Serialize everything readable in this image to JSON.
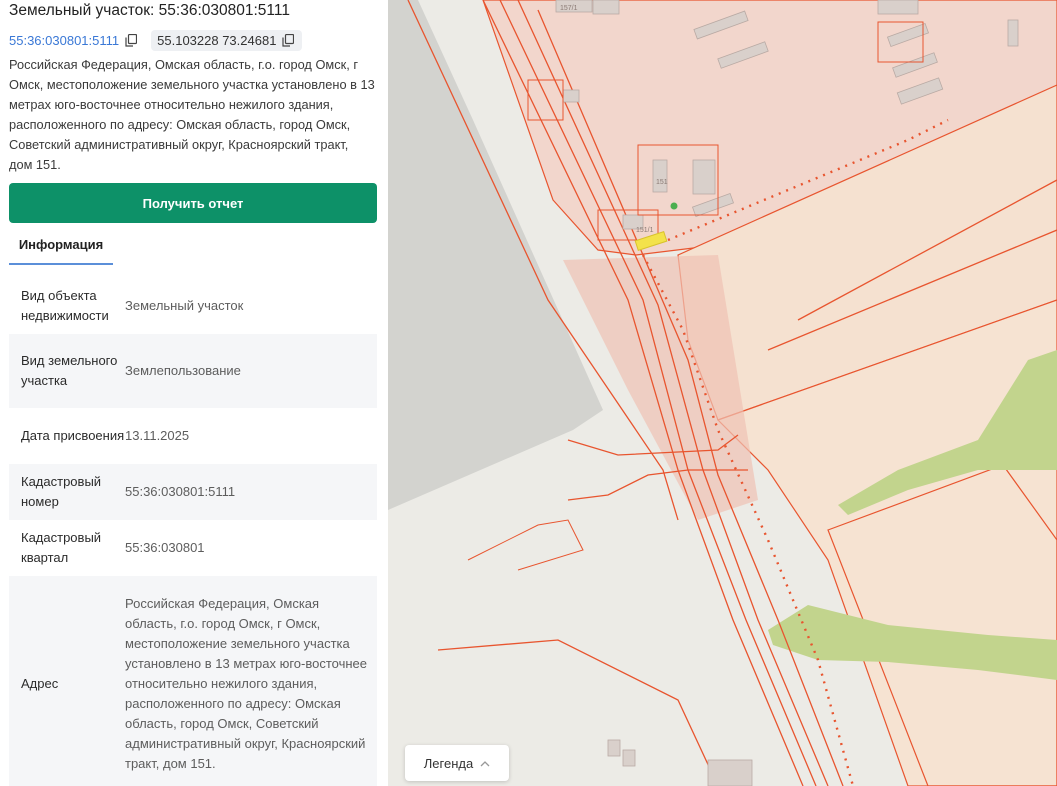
{
  "header": {
    "title": "Земельный участок: 55:36:030801:5111",
    "cadastral_link": "55:36:030801:5111",
    "coordinates": "55.103228 73.24681"
  },
  "description": "Российская Федерация, Омская область, г.о. город Омск, г Омск, местоположение земельного участка установлено в 13 метрах юго-восточнее относительно нежилого здания, расположенного по адресу: Омская область, город Омск, Советский административный округ, Красноярский тракт, дом 151.",
  "report_button": "Получить отчет",
  "tabs": [
    {
      "label": "Информация",
      "active": true
    }
  ],
  "info_rows": [
    {
      "key": "Вид объекта недвижимости",
      "value": "Земельный участок"
    },
    {
      "key": "Вид земельного участка",
      "value": "Землепользование"
    },
    {
      "key": "Дата присвоения",
      "value": "13.11.2025"
    },
    {
      "key": "Кадастровый номер",
      "value": "55:36:030801:5111"
    },
    {
      "key": "Кадастровый квартал",
      "value": "55:36:030801"
    },
    {
      "key": "Адрес",
      "value": "Российская Федерация, Омская область, г.о. город Омск, г Омск, местоположение земельного участка установлено в 13 метрах юго-восточнее относительно нежилого здания, расположенного по адресу: Омская область, город Омск, Советский административный округ, Красноярский тракт, дом 151."
    }
  ],
  "map": {
    "building_labels": [
      "157/1",
      "151",
      "151/1"
    ],
    "legend_label": "Легенда"
  },
  "colors": {
    "accent_green": "#0d9168",
    "link_blue": "#3a78d6",
    "parcel_stroke": "#e8552f",
    "parcel_fill": "#f4cfc3",
    "selected_parcel": "#f3e24a",
    "vegetation": "#c2d48d"
  },
  "icons": [
    "copy-icon",
    "chevron-up-icon"
  ]
}
